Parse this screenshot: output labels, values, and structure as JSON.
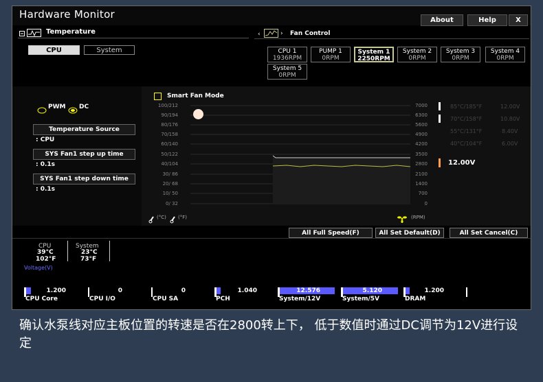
{
  "window": {
    "title": "Hardware Monitor",
    "about": "About",
    "help": "Help",
    "close": "X"
  },
  "temperature": {
    "title": "Temperature",
    "tabs": [
      "CPU",
      "System"
    ],
    "active_tab": "CPU"
  },
  "fan_control": {
    "title": "Fan Control",
    "fans": [
      {
        "name": "CPU 1",
        "rpm": "1936RPM",
        "selected": false
      },
      {
        "name": "PUMP 1",
        "rpm": "0RPM",
        "selected": false
      },
      {
        "name": "System 1",
        "rpm": "2250RPM",
        "selected": true
      },
      {
        "name": "System 2",
        "rpm": "0RPM",
        "selected": false
      },
      {
        "name": "System 3",
        "rpm": "0RPM",
        "selected": false
      },
      {
        "name": "System 4",
        "rpm": "0RPM",
        "selected": false
      },
      {
        "name": "System 5",
        "rpm": "0RPM",
        "selected": false
      }
    ]
  },
  "side": {
    "pwm": "PWM",
    "dc": "DC",
    "mode_selected": "DC",
    "temp_source_label": "Temperature Source",
    "temp_source_value": ": CPU",
    "step_up_label": "SYS Fan1 step up time",
    "step_up_value": ": 0.1s",
    "step_down_label": "SYS Fan1 step down time",
    "step_down_value": ": 0.1s"
  },
  "graph": {
    "smart_fan_mode": "Smart Fan Mode",
    "temp_ticks": [
      "100/212",
      "90/194",
      "80/176",
      "70/158",
      "60/140",
      "50/122",
      "40/104",
      "30/ 86",
      "20/ 68",
      "10/ 50",
      "0/ 32"
    ],
    "rpm_ticks": [
      "7000",
      "6300",
      "5600",
      "4900",
      "4200",
      "3500",
      "2800",
      "2100",
      "1400",
      "700",
      "0"
    ],
    "unit_c": "(°C)",
    "unit_f": "(°F)",
    "unit_rpm": "(RPM)",
    "voltage_legend": [
      {
        "temp": "85°C/185°F",
        "volt": "12.00V"
      },
      {
        "temp": "70°C/158°F",
        "volt": "10.80V"
      },
      {
        "temp": "55°C/131°F",
        "volt": "8.40V"
      },
      {
        "temp": "40°C/104°F",
        "volt": "6.00V"
      }
    ],
    "current_voltage": "12.00V",
    "rpm_current": 2500
  },
  "actions": {
    "full_speed": "All Full Speed(F)",
    "set_default": "All Set Default(D)",
    "set_cancel": "All Set Cancel(C)"
  },
  "readout": {
    "cpu_label": "CPU",
    "cpu_c": "39°C",
    "cpu_f": "102°F",
    "sys_label": "System",
    "sys_c": "23°C",
    "sys_f": "73°F",
    "voltage_label": "Voltage(V)"
  },
  "voltages": [
    {
      "label": "CPU Core",
      "value": "1.200",
      "fill": 0.12
    },
    {
      "label": "CPU I/O",
      "value": "0",
      "fill": 0
    },
    {
      "label": "CPU SA",
      "value": "0",
      "fill": 0
    },
    {
      "label": "PCH",
      "value": "1.040",
      "fill": 0.1
    },
    {
      "label": "System/12V",
      "value": "12.576",
      "fill": 1.0
    },
    {
      "label": "System/5V",
      "value": "5.120",
      "fill": 1.0
    },
    {
      "label": "DRAM",
      "value": "1.200",
      "fill": 0.12
    }
  ],
  "colors": {
    "fill_blue": "#5a5aff",
    "trace_yellow": "#b8c040",
    "warn_orange": "#ff9b4a"
  },
  "caption": "确认水泵线对应主板位置的转速是否在2800转上下， 低于数值时通过DC调节为12V进行设定"
}
